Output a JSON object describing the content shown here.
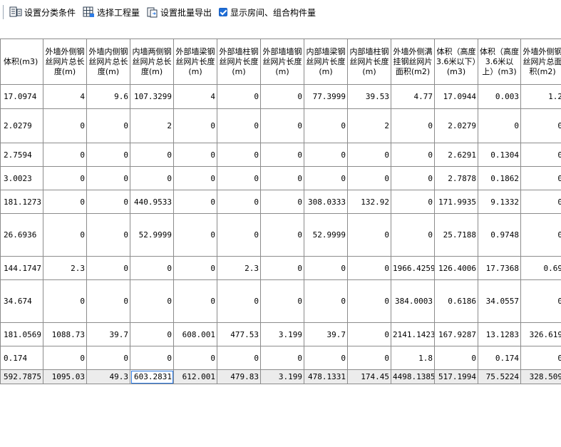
{
  "toolbar": {
    "set_category_label": "设置分类条件",
    "select_project_label": "选择工程量",
    "batch_export_label": "设置批量导出",
    "show_rooms_label": "显示房间、组合构件量",
    "show_rooms_checked": true
  },
  "table": {
    "headers": [
      "体积(m3)",
      "外墙外侧钢丝网片总长度(m)",
      "外墙内侧钢丝网片总长度(m)",
      "内墙两侧钢丝网片总长度(m)",
      "外部墙梁钢丝网片长度(m)",
      "外部墙柱钢丝网片长度(m)",
      "外部墙墙钢丝网片长度(m)",
      "内部墙梁钢丝网片长度(m)",
      "内部墙柱钢丝网片长度(m)",
      "外墙外侧满挂钢丝网片面积(m2)",
      "体积（高度3.6米以下）(m3)",
      "体积（高度3.6米以上）(m3)",
      "外墙外侧钢丝网片总面积(m2)"
    ],
    "rows": [
      [
        "17.0974",
        "4",
        "9.6",
        "107.3299",
        "4",
        "0",
        "0",
        "77.3999",
        "39.53",
        "4.77",
        "17.0944",
        "0.003",
        "1.2"
      ],
      [
        "2.0279",
        "0",
        "0",
        "2",
        "0",
        "0",
        "0",
        "0",
        "2",
        "0",
        "2.0279",
        "0",
        "0"
      ],
      [
        "2.7594",
        "0",
        "0",
        "0",
        "0",
        "0",
        "0",
        "0",
        "0",
        "0",
        "2.6291",
        "0.1304",
        "0"
      ],
      [
        "3.0023",
        "0",
        "0",
        "0",
        "0",
        "0",
        "0",
        "0",
        "0",
        "0",
        "2.7878",
        "0.1862",
        "0"
      ],
      [
        "181.1273",
        "0",
        "0",
        "440.9533",
        "0",
        "0",
        "0",
        "308.0333",
        "132.92",
        "0",
        "171.9935",
        "9.1332",
        "0"
      ],
      [
        "26.6936",
        "0",
        "0",
        "52.9999",
        "0",
        "0",
        "0",
        "52.9999",
        "0",
        "0",
        "25.7188",
        "0.9748",
        "0"
      ],
      [
        "144.1747",
        "2.3",
        "0",
        "0",
        "0",
        "2.3",
        "0",
        "0",
        "0",
        "1966.4259",
        "126.4006",
        "17.7368",
        "0.69"
      ],
      [
        "34.674",
        "0",
        "0",
        "0",
        "0",
        "0",
        "0",
        "0",
        "0",
        "384.0003",
        "0.6186",
        "34.0557",
        "0"
      ],
      [
        "181.0569",
        "1088.73",
        "39.7",
        "0",
        "608.001",
        "477.53",
        "3.199",
        "39.7",
        "0",
        "2141.1423",
        "167.9287",
        "13.1283",
        "326.619"
      ],
      [
        "0.174",
        "0",
        "0",
        "0",
        "0",
        "0",
        "0",
        "0",
        "0",
        "1.8",
        "0",
        "0.174",
        "0"
      ]
    ],
    "total_row": [
      "592.7875",
      "1095.03",
      "49.3",
      "603.2831",
      "612.001",
      "479.83",
      "3.199",
      "478.1331",
      "174.45",
      "4498.1385",
      "517.1994",
      "75.5224",
      "328.509"
    ]
  }
}
